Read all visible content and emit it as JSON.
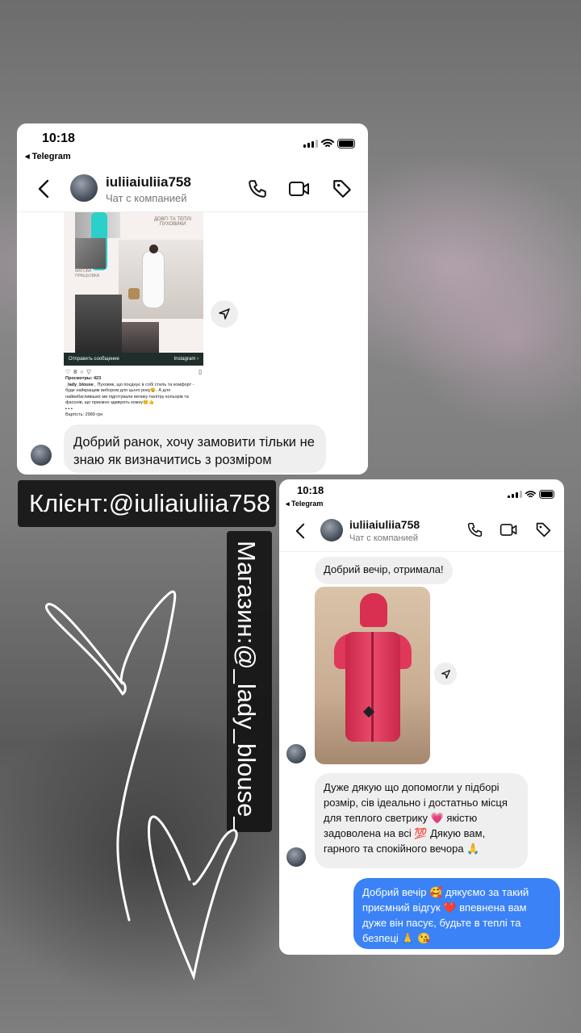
{
  "screenshot1": {
    "time": "10:18",
    "back_app": "◂ Telegram",
    "contact_name": "iuliiaiuliia758",
    "contact_sub": "Чат с компанией",
    "post": {
      "heading": "ДОВГІ ТА ТЕПЛІ ПУХОВИКИ",
      "tag": "МАТОВА ПРАЦЬОВКА",
      "send_bar_label": "Отправить сообщение",
      "send_bar_brand": "Instagram",
      "likes": "8",
      "views": "Просмотры: 423",
      "caption_user": "_lady_blouse_",
      "caption": "Пуховик, що поєднує в собі стиль та комфорт - буде найкращим вибором для цього року😉. А для найвибагливіших ми підготували велику палітру кольорів та фасонів, що приємно здивують кожну😊👍",
      "dots": "▪ ▪ ▪",
      "price": "Вартість: 2989 грн"
    },
    "message": "Добрий ранок, хочу замовити тільки не знаю як визначитись з розміром"
  },
  "label_client": "Клієнт:@iuliaiuliia758",
  "label_shop": "Магазин:@_lady_blouse_",
  "screenshot2": {
    "time": "10:18",
    "back_app": "◂ Telegram",
    "contact_name": "iuliiaiuliia758",
    "contact_sub": "Чат с компанией",
    "msg1": "Добрий вечір, отримала!",
    "msg2": "Дуже дякую що допомогли у підборі розмір, сів ідеально і достатньо місця для теплого светрику 💗 якістю задоволена на всі 💯 Дякую вам, гарного та спокійного вечора 🙏",
    "msg3": "Добрий вечір 🥰 дякуємо за такий приємний відгук ❤️ впевнена вам дуже він пасує, будьте в теплі та безпеці 🙏 😘"
  },
  "colors": {
    "accent": "#3b82f6",
    "bubble": "#efefef",
    "jacket": "#e0385a",
    "teal": "#2ad0c9"
  }
}
